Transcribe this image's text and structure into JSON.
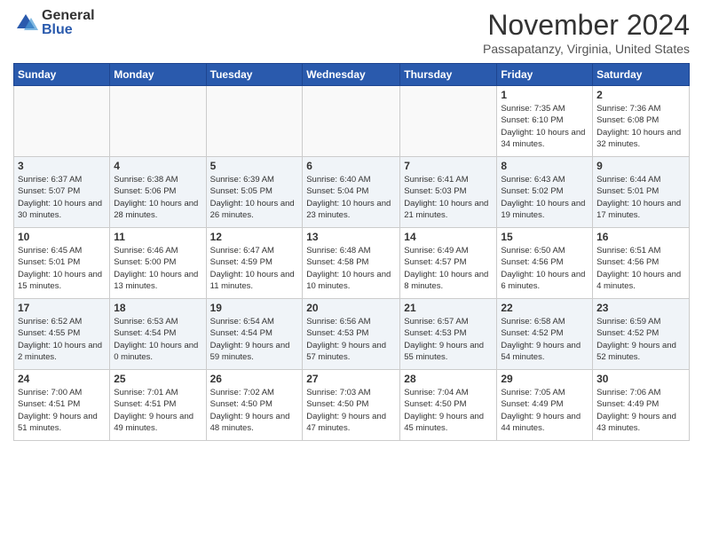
{
  "logo": {
    "general": "General",
    "blue": "Blue"
  },
  "header": {
    "month": "November 2024",
    "location": "Passapatanzy, Virginia, United States"
  },
  "weekdays": [
    "Sunday",
    "Monday",
    "Tuesday",
    "Wednesday",
    "Thursday",
    "Friday",
    "Saturday"
  ],
  "weeks": [
    [
      {
        "day": "",
        "info": ""
      },
      {
        "day": "",
        "info": ""
      },
      {
        "day": "",
        "info": ""
      },
      {
        "day": "",
        "info": ""
      },
      {
        "day": "",
        "info": ""
      },
      {
        "day": "1",
        "info": "Sunrise: 7:35 AM\nSunset: 6:10 PM\nDaylight: 10 hours and 34 minutes."
      },
      {
        "day": "2",
        "info": "Sunrise: 7:36 AM\nSunset: 6:08 PM\nDaylight: 10 hours and 32 minutes."
      }
    ],
    [
      {
        "day": "3",
        "info": "Sunrise: 6:37 AM\nSunset: 5:07 PM\nDaylight: 10 hours and 30 minutes."
      },
      {
        "day": "4",
        "info": "Sunrise: 6:38 AM\nSunset: 5:06 PM\nDaylight: 10 hours and 28 minutes."
      },
      {
        "day": "5",
        "info": "Sunrise: 6:39 AM\nSunset: 5:05 PM\nDaylight: 10 hours and 26 minutes."
      },
      {
        "day": "6",
        "info": "Sunrise: 6:40 AM\nSunset: 5:04 PM\nDaylight: 10 hours and 23 minutes."
      },
      {
        "day": "7",
        "info": "Sunrise: 6:41 AM\nSunset: 5:03 PM\nDaylight: 10 hours and 21 minutes."
      },
      {
        "day": "8",
        "info": "Sunrise: 6:43 AM\nSunset: 5:02 PM\nDaylight: 10 hours and 19 minutes."
      },
      {
        "day": "9",
        "info": "Sunrise: 6:44 AM\nSunset: 5:01 PM\nDaylight: 10 hours and 17 minutes."
      }
    ],
    [
      {
        "day": "10",
        "info": "Sunrise: 6:45 AM\nSunset: 5:01 PM\nDaylight: 10 hours and 15 minutes."
      },
      {
        "day": "11",
        "info": "Sunrise: 6:46 AM\nSunset: 5:00 PM\nDaylight: 10 hours and 13 minutes."
      },
      {
        "day": "12",
        "info": "Sunrise: 6:47 AM\nSunset: 4:59 PM\nDaylight: 10 hours and 11 minutes."
      },
      {
        "day": "13",
        "info": "Sunrise: 6:48 AM\nSunset: 4:58 PM\nDaylight: 10 hours and 10 minutes."
      },
      {
        "day": "14",
        "info": "Sunrise: 6:49 AM\nSunset: 4:57 PM\nDaylight: 10 hours and 8 minutes."
      },
      {
        "day": "15",
        "info": "Sunrise: 6:50 AM\nSunset: 4:56 PM\nDaylight: 10 hours and 6 minutes."
      },
      {
        "day": "16",
        "info": "Sunrise: 6:51 AM\nSunset: 4:56 PM\nDaylight: 10 hours and 4 minutes."
      }
    ],
    [
      {
        "day": "17",
        "info": "Sunrise: 6:52 AM\nSunset: 4:55 PM\nDaylight: 10 hours and 2 minutes."
      },
      {
        "day": "18",
        "info": "Sunrise: 6:53 AM\nSunset: 4:54 PM\nDaylight: 10 hours and 0 minutes."
      },
      {
        "day": "19",
        "info": "Sunrise: 6:54 AM\nSunset: 4:54 PM\nDaylight: 9 hours and 59 minutes."
      },
      {
        "day": "20",
        "info": "Sunrise: 6:56 AM\nSunset: 4:53 PM\nDaylight: 9 hours and 57 minutes."
      },
      {
        "day": "21",
        "info": "Sunrise: 6:57 AM\nSunset: 4:53 PM\nDaylight: 9 hours and 55 minutes."
      },
      {
        "day": "22",
        "info": "Sunrise: 6:58 AM\nSunset: 4:52 PM\nDaylight: 9 hours and 54 minutes."
      },
      {
        "day": "23",
        "info": "Sunrise: 6:59 AM\nSunset: 4:52 PM\nDaylight: 9 hours and 52 minutes."
      }
    ],
    [
      {
        "day": "24",
        "info": "Sunrise: 7:00 AM\nSunset: 4:51 PM\nDaylight: 9 hours and 51 minutes."
      },
      {
        "day": "25",
        "info": "Sunrise: 7:01 AM\nSunset: 4:51 PM\nDaylight: 9 hours and 49 minutes."
      },
      {
        "day": "26",
        "info": "Sunrise: 7:02 AM\nSunset: 4:50 PM\nDaylight: 9 hours and 48 minutes."
      },
      {
        "day": "27",
        "info": "Sunrise: 7:03 AM\nSunset: 4:50 PM\nDaylight: 9 hours and 47 minutes."
      },
      {
        "day": "28",
        "info": "Sunrise: 7:04 AM\nSunset: 4:50 PM\nDaylight: 9 hours and 45 minutes."
      },
      {
        "day": "29",
        "info": "Sunrise: 7:05 AM\nSunset: 4:49 PM\nDaylight: 9 hours and 44 minutes."
      },
      {
        "day": "30",
        "info": "Sunrise: 7:06 AM\nSunset: 4:49 PM\nDaylight: 9 hours and 43 minutes."
      }
    ]
  ]
}
